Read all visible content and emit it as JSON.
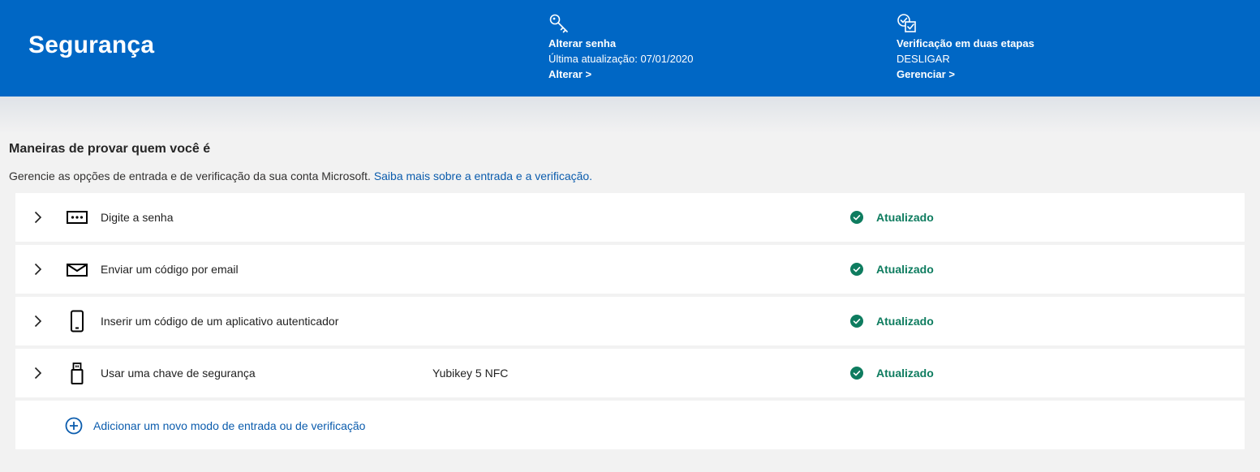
{
  "header": {
    "title": "Segurança",
    "password_card": {
      "icon": "key-icon",
      "title": "Alterar senha",
      "subtitle": "Última atualização: 07/01/2020",
      "link": "Alterar >"
    },
    "two_step_card": {
      "icon": "check-shield-icon",
      "title": "Verificação em duas etapas",
      "subtitle": "DESLIGAR",
      "link": "Gerenciar >"
    },
    "background_color": "#0067c5"
  },
  "section": {
    "title": "Maneiras de provar quem você é",
    "description": "Gerencie as opções de entrada e de verificação da sua conta Microsoft.",
    "learn_more_link": "Saiba mais sobre a entrada e a verificação."
  },
  "methods": [
    {
      "icon": "password-icon",
      "label": "Digite a senha",
      "detail": "",
      "status": "Atualizado"
    },
    {
      "icon": "email-icon",
      "label": "Enviar um código por email",
      "detail": "",
      "status": "Atualizado"
    },
    {
      "icon": "phone-icon",
      "label": "Inserir um código de um aplicativo autenticador",
      "detail": "",
      "status": "Atualizado"
    },
    {
      "icon": "usb-key-icon",
      "label": "Usar uma chave de segurança",
      "detail": "Yubikey 5 NFC",
      "status": "Atualizado"
    }
  ],
  "add_method": {
    "icon": "add-circle-icon",
    "label": "Adicionar um novo modo de entrada ou de verificação"
  },
  "colors": {
    "link": "#0b5cad",
    "status": "#0e7c5f",
    "page_background": "#f2f2f2"
  }
}
